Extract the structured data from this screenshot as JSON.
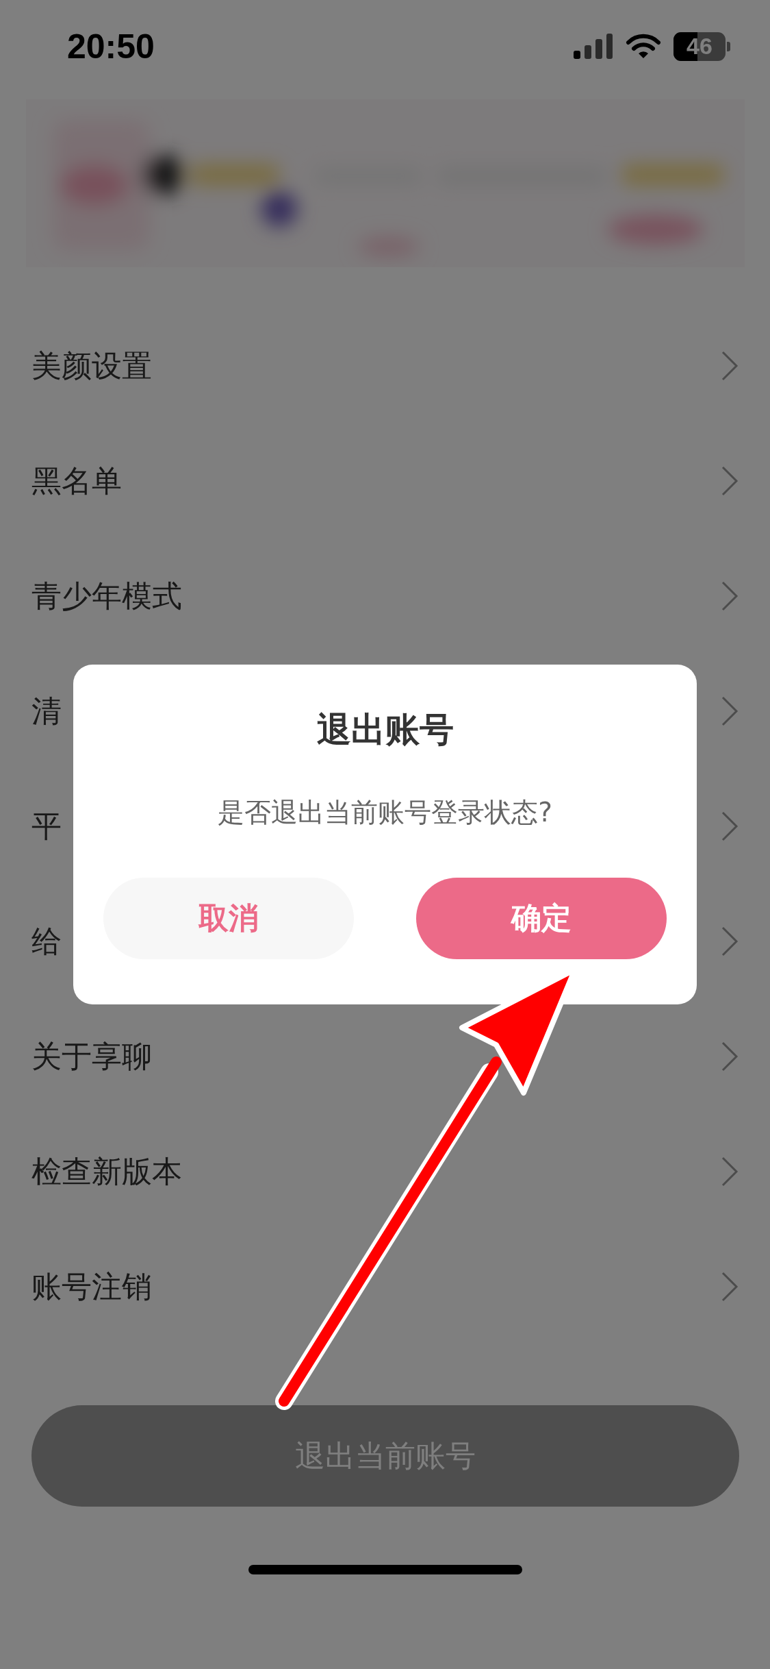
{
  "status_bar": {
    "time": "20:50",
    "battery": {
      "text": "46",
      "level": 0.46
    }
  },
  "menu": [
    {
      "label": "美颜设置"
    },
    {
      "label": "黑名单"
    },
    {
      "label": "青少年模式"
    },
    {
      "label": "清"
    },
    {
      "label": "平"
    },
    {
      "label": "给"
    },
    {
      "label": "关于享聊"
    },
    {
      "label": "检查新版本"
    },
    {
      "label": "账号注销"
    }
  ],
  "logout_button": "退出当前账号",
  "dialog": {
    "title": "退出账号",
    "message": "是否退出当前账号登录状态?",
    "buttons": [
      {
        "label": "取消",
        "kind": "secondary"
      },
      {
        "label": "确定",
        "kind": "primary"
      }
    ]
  }
}
